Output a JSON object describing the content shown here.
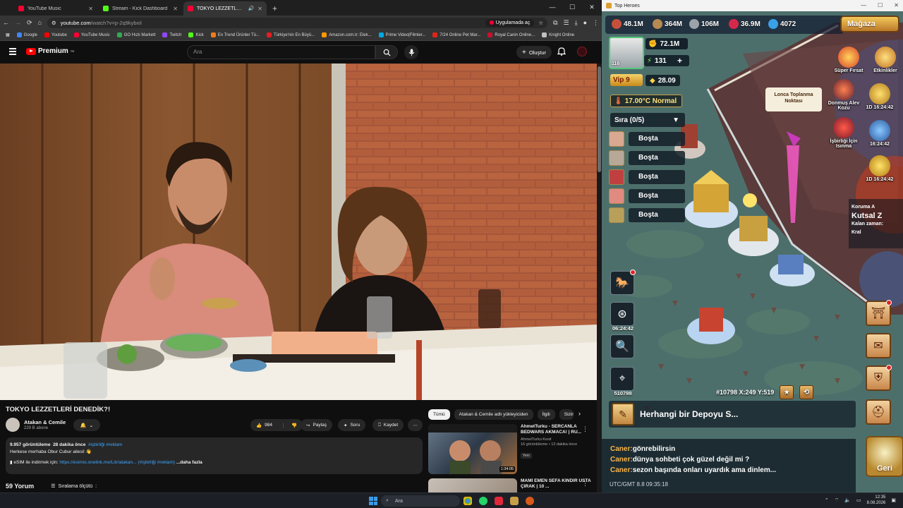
{
  "browser": {
    "tabs": [
      {
        "title": "YouTube Music",
        "color": "#ff0033",
        "active": false
      },
      {
        "title": "Stream - Kick Dashboard",
        "color": "#53fc18",
        "active": false
      },
      {
        "title": "TOKYO LEZZETLERİ DENEDİ",
        "color": "#ff0033",
        "active": true
      }
    ],
    "url_site": "youtube.com",
    "url_path": "/watch?v=p-2q9kybxiI",
    "app_chip": "Uygulamada aç",
    "bookmarks": [
      {
        "label": "Google",
        "color": "#4285f4"
      },
      {
        "label": "Youtube",
        "color": "#ff0000"
      },
      {
        "label": "YouTube Music",
        "color": "#ff0033"
      },
      {
        "label": "GO Hızlı Markett",
        "color": "#34a853"
      },
      {
        "label": "Twitch",
        "color": "#9146ff"
      },
      {
        "label": "Kick",
        "color": "#53fc18"
      },
      {
        "label": "En Trend Ürünler Tü...",
        "color": "#f27a1a"
      },
      {
        "label": "Türkiye'nin En Büyü...",
        "color": "#e31e24"
      },
      {
        "label": "Amazon.com.tr: Elek...",
        "color": "#ff9900"
      },
      {
        "label": "Prime Video|Filmler...",
        "color": "#00a8e1"
      },
      {
        "label": "7/24 Online Pet Mar...",
        "color": "#e2231a"
      },
      {
        "label": "Royal Canin Online...",
        "color": "#c8102e"
      },
      {
        "label": "Knight Online",
        "color": "#c0c0c0"
      }
    ]
  },
  "youtube": {
    "logo": "Premium",
    "logo_sup": "TR",
    "search_placeholder": "Ara",
    "create_label": "Oluştur",
    "video_title": "TOKYO LEZZETLERİ DENEDİK?!",
    "channel_name": "Atakan & Cemile",
    "channel_subs": "229 B abone",
    "likes": "984",
    "share": "Paylaş",
    "ask": "Soru",
    "save": "Kaydet",
    "desc_views": "9.957 görüntüleme",
    "desc_time": "28 dakika önce",
    "desc_tags": "#işbirliği #reklam",
    "desc_line1": "Herkese merhaba Obur Cubur ailesi! 👋",
    "desc_line2_prefix": "eSIM ile indirmek için: ",
    "desc_link": "https://esimio.onelink.me/Litr/atakan...",
    "desc_line2_tags": "(#işbirliği #reklam)",
    "desc_more": "...daha fazla",
    "comments": "59 Yorum",
    "sort": "Sıralama ölçütü",
    "chips": [
      "Tümü",
      "Atakan & Cemile adlı yükleyiciden",
      "İlgili",
      "Sizin"
    ],
    "recos": [
      {
        "title": "AhmetTurku - SERCANLA BEDWARS AKMACA! | RU...",
        "channel": "AhmetTurku Kesit",
        "meta": "16 görüntüleme • 13 dakika önce",
        "badge": "Yeni",
        "duration": "1:34:05"
      },
      {
        "title": "MAMİ EMEN SEFA KINDIR USTA ÇIRAK | 10 ...",
        "channel": "",
        "meta": "",
        "badge": "",
        "duration": ""
      }
    ]
  },
  "game": {
    "window_title": "Top Heroes",
    "resources": [
      "48.1M",
      "364M",
      "106M",
      "36.9M",
      "4072"
    ],
    "shop": "Mağaza",
    "player_level": "116",
    "power": "72.1M",
    "energy": "131",
    "vip": "Vip 9",
    "vip_value": "28.09",
    "temperature": "17.00°C Normal",
    "queue": "Sıra (0/5)",
    "slots": [
      "Boşta",
      "Boşta",
      "Boşta",
      "Boşta",
      "Boşta"
    ],
    "rally_point": "Lonca Toplanma Noktası",
    "events": [
      {
        "label": "Süper Fırsat",
        "timer": ""
      },
      {
        "label": "Etkinlikler",
        "timer": ""
      },
      {
        "label": "Donmuş Alev Kozu",
        "timer": "1D 16:24:42"
      },
      {
        "label": "İşbirliği İçin Isınma",
        "timer": "16:24:42"
      },
      {
        "label": "",
        "timer": "1D 16:24:42"
      }
    ],
    "kutsal_header": "Koruma A",
    "kutsal_title": "Kutsal Z",
    "kutsal_time_label": "Kalan zaman:",
    "kutsal_king": "Kral",
    "side_timer": "06:24:42",
    "side_number": "510798",
    "coords": "#10798 X:249 Y:519",
    "quest": "Herhangi bir Depoyu S...",
    "chat": [
      {
        "who": "Caner:",
        "msg": "gönrebilirsin"
      },
      {
        "who": "Caner:",
        "msg": "dünya sohbeti çok güzel değil mi ?"
      },
      {
        "who": "Caner:",
        "msg": "sezon başında onları uyardık ama dinlem..."
      }
    ],
    "utc": "UTC/GMT 8.8 09:35:18",
    "back": "Geri"
  },
  "taskbar": {
    "search": "Ara",
    "time": "12:35",
    "date": "8.08.2026"
  }
}
